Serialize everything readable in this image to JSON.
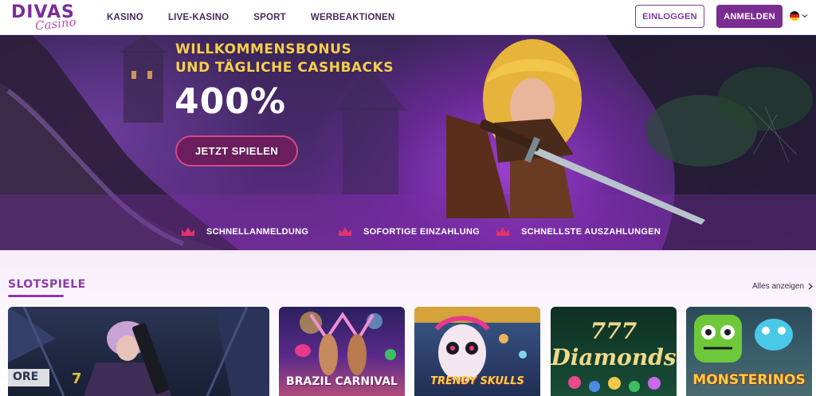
{
  "header": {
    "logo_main": "DIVAS",
    "logo_sub": "Casino",
    "nav": [
      "KASINO",
      "LIVE-KASINO",
      "SPORT",
      "WERBEAKTIONEN"
    ],
    "login_label": "EINLOGGEN",
    "register_label": "ANMELDEN",
    "language_icon": "germany-flag-icon"
  },
  "hero": {
    "line1": "WILLKOMMENSBONUS",
    "line2": "UND TÄGLICHE CASHBACKS",
    "amount": "400%",
    "cta_label": "JETZT SPIELEN",
    "features": [
      "SCHNELLANMELDUNG",
      "SOFORTIGE EINZAHLUNG",
      "SCHNELLSTE AUSZAHLUNGEN"
    ],
    "feature_icon": "crown-icon"
  },
  "slots": {
    "title": "SLOTSPIELE",
    "show_all": "Alles anzeigen",
    "games": [
      {
        "name": "",
        "art_label": "ORE"
      },
      {
        "name": "BRAZIL CARNIVAL"
      },
      {
        "name": "TRENDY SKULLS"
      },
      {
        "name": "777 Diamonds"
      },
      {
        "name": "MONSTERINOS"
      }
    ]
  },
  "colors": {
    "brand_purple": "#7a2d90",
    "gold": "#f6cf4a",
    "accent_pink": "#d6478f"
  }
}
